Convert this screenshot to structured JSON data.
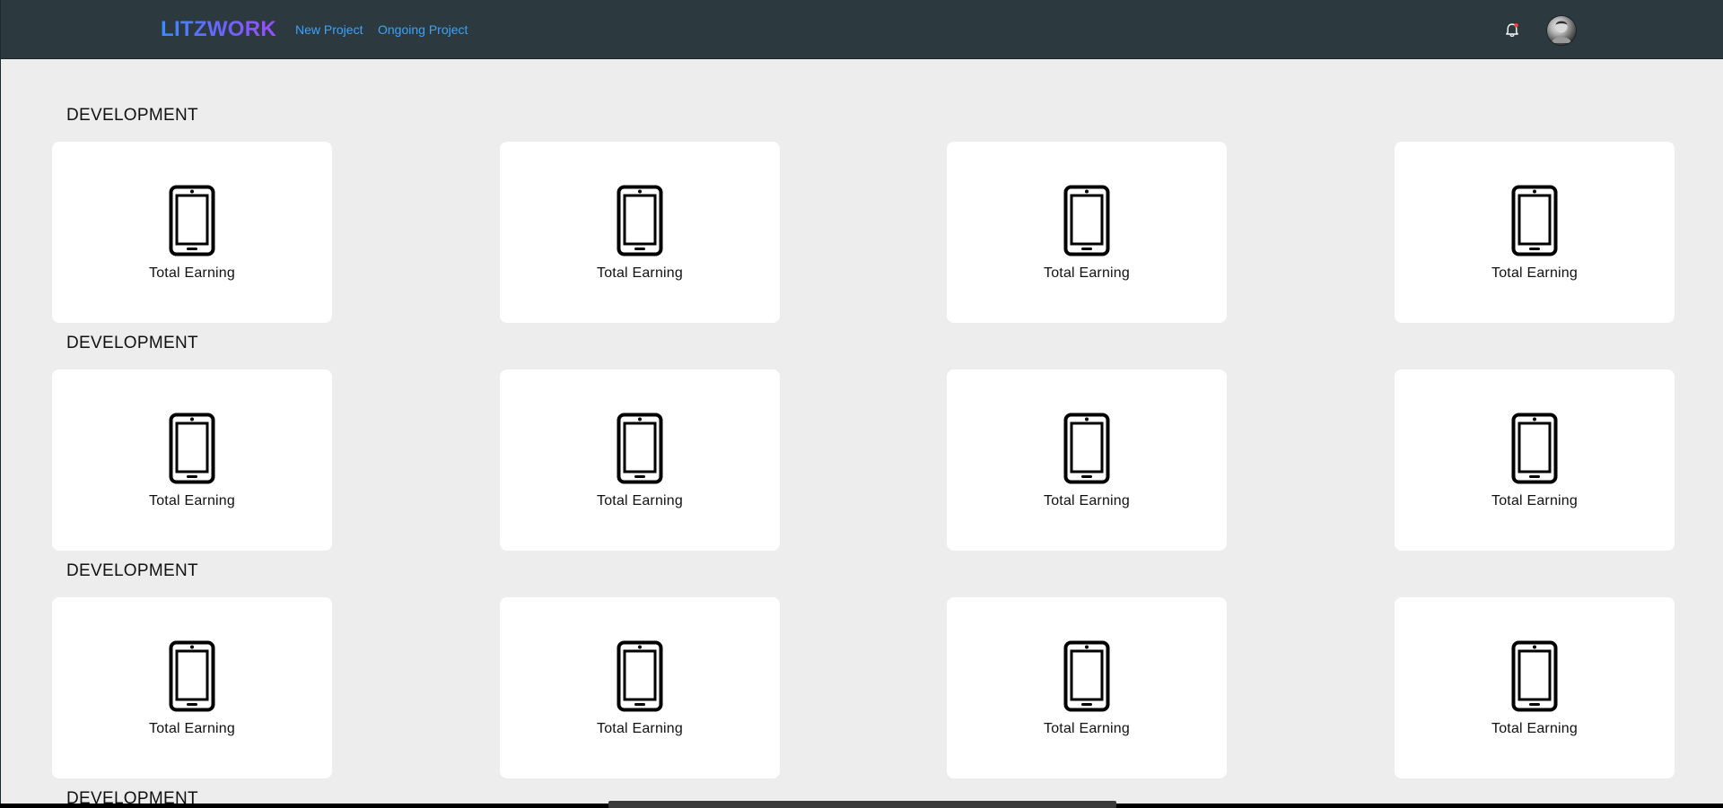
{
  "header": {
    "brand": "LITZWORK",
    "nav": [
      "New Project",
      "Ongoing Project"
    ],
    "notification_icon": "bell-icon",
    "avatar_icon": "user-avatar"
  },
  "sections": [
    {
      "title": "DEVELOPMENT",
      "cards": [
        {
          "label": "Total Earning",
          "icon": "phone-icon"
        },
        {
          "label": "Total Earning",
          "icon": "phone-icon"
        },
        {
          "label": "Total Earning",
          "icon": "phone-icon"
        },
        {
          "label": "Total Earning",
          "icon": "phone-icon"
        }
      ]
    },
    {
      "title": "DEVELOPMENT",
      "cards": [
        {
          "label": "Total Earning",
          "icon": "phone-icon"
        },
        {
          "label": "Total Earning",
          "icon": "phone-icon"
        },
        {
          "label": "Total Earning",
          "icon": "phone-icon"
        },
        {
          "label": "Total Earning",
          "icon": "phone-icon"
        }
      ]
    },
    {
      "title": "DEVELOPMENT",
      "cards": [
        {
          "label": "Total Earning",
          "icon": "phone-icon"
        },
        {
          "label": "Total Earning",
          "icon": "phone-icon"
        },
        {
          "label": "Total Earning",
          "icon": "phone-icon"
        },
        {
          "label": "Total Earning",
          "icon": "phone-icon"
        }
      ]
    },
    {
      "title": "DEVELOPMENT",
      "cards": []
    }
  ],
  "colors": {
    "topbar": "#2c3a3f",
    "page_background": "#ededed",
    "link": "#3aa3ff",
    "brand_gradient_start": "#3b8bff",
    "brand_gradient_end": "#9b4dff",
    "notification_dot": "#ff3b3b"
  }
}
